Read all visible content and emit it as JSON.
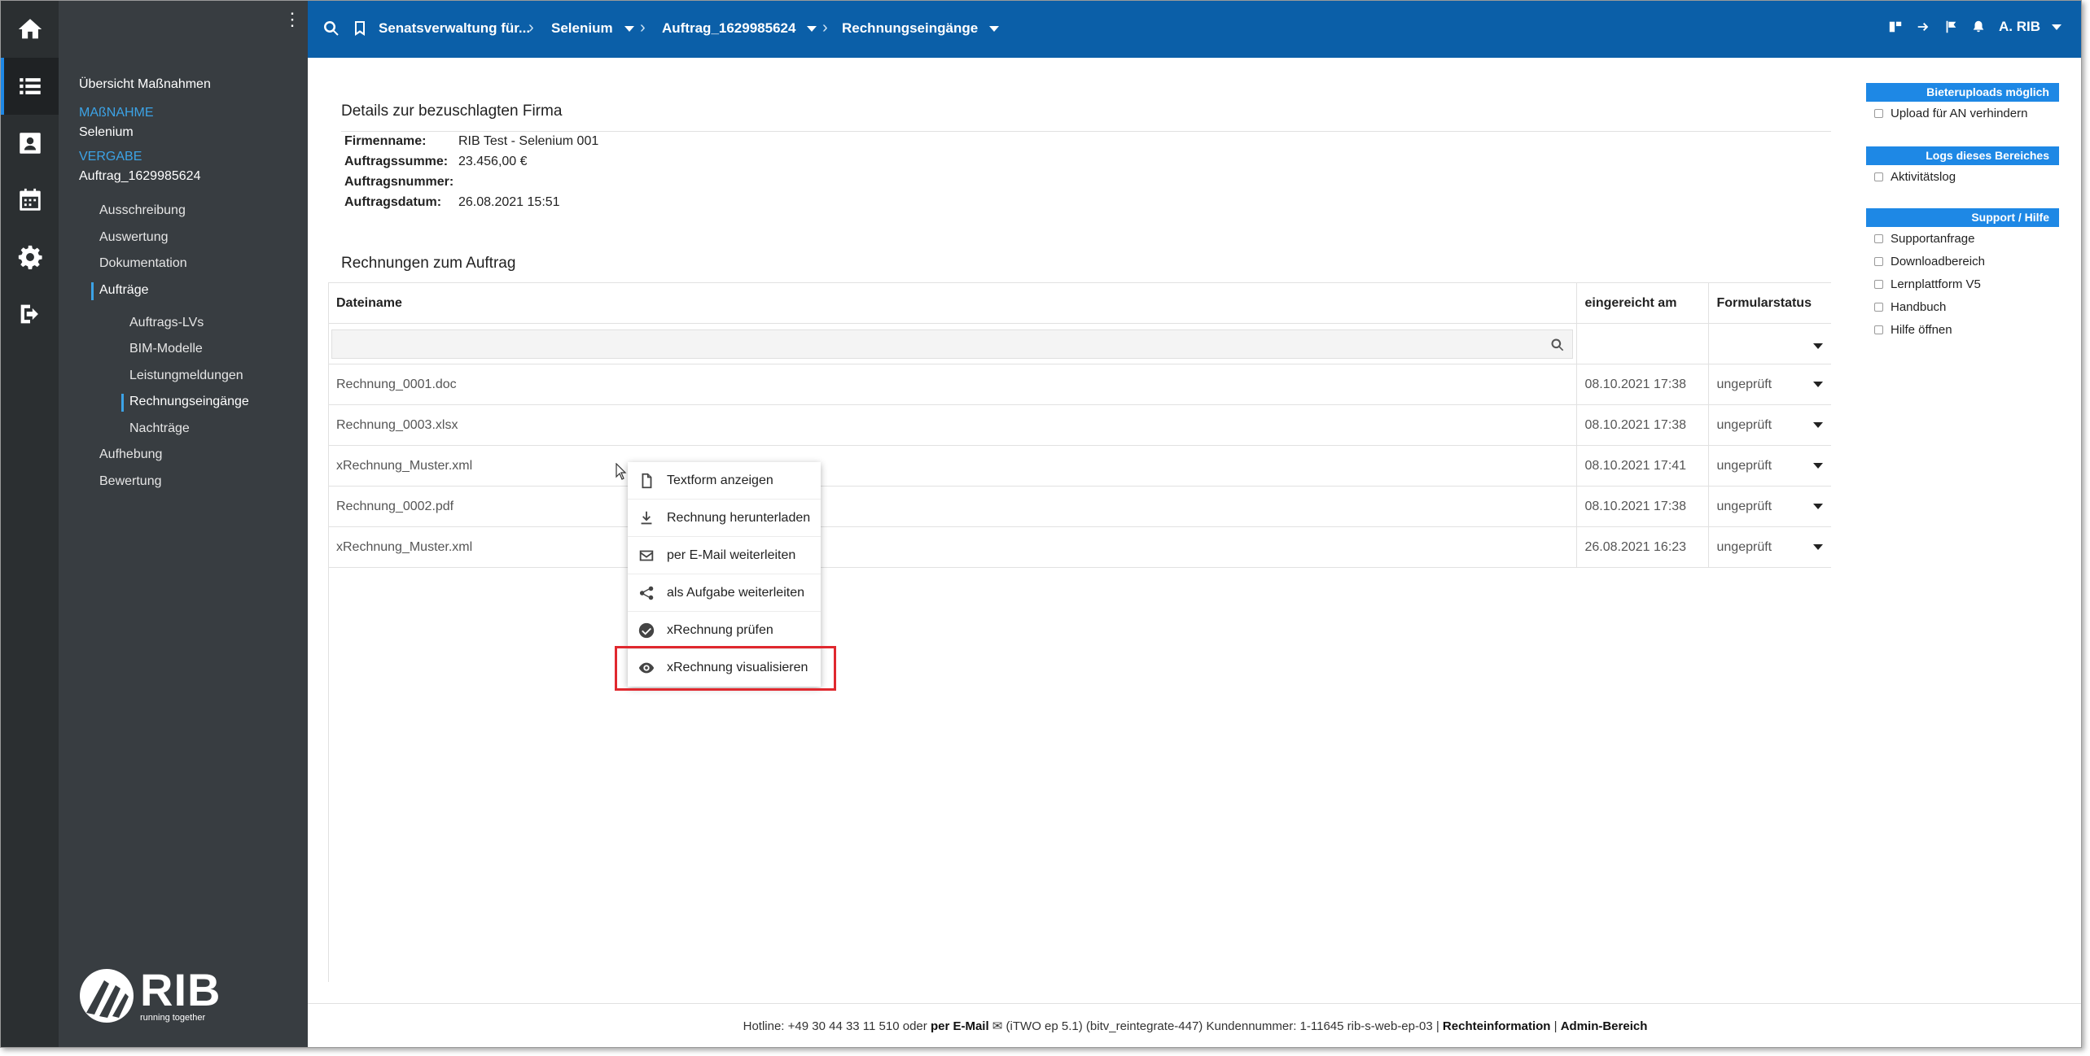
{
  "nav": {
    "overview": "Übersicht Maßnahmen",
    "massnahme_label": "MAßNAHME",
    "massnahme_value": "Selenium",
    "vergabe_label": "VERGABE",
    "vergabe_value": "Auftrag_1629985624",
    "items": [
      "Ausschreibung",
      "Auswertung",
      "Dokumentation",
      "Aufträge"
    ],
    "subitems": [
      "Auftrags-LVs",
      "BIM-Modelle",
      "Leistungmeldungen",
      "Rechnungseingänge",
      "Nachträge"
    ],
    "items_after": [
      "Aufhebung",
      "Bewertung"
    ],
    "logo_text": "RIB",
    "logo_tagline": "running together"
  },
  "topbar": {
    "crumbs": [
      "Senatsverwaltung für...",
      "Selenium",
      "Auftrag_1629985624",
      "Rechnungseingänge"
    ],
    "user": "A. RIB"
  },
  "details": {
    "title": "Details zur bezuschlagten Firma",
    "rows": [
      {
        "k": "Firmenname:",
        "v": "RIB Test - Selenium 001"
      },
      {
        "k": "Auftragssumme:",
        "v": "23.456,00 €"
      },
      {
        "k": "Auftragsnummer:",
        "v": ""
      },
      {
        "k": "Auftragsdatum:",
        "v": "26.08.2021 15:51"
      }
    ]
  },
  "invoices": {
    "title": "Rechnungen zum Auftrag",
    "columns": [
      "Dateiname",
      "eingereicht am",
      "Formularstatus"
    ],
    "rows": [
      {
        "file": "Rechnung_0001.doc",
        "date": "08.10.2021 17:38",
        "status": "ungeprüft"
      },
      {
        "file": "Rechnung_0003.xlsx",
        "date": "08.10.2021 17:38",
        "status": "ungeprüft"
      },
      {
        "file": "xRechnung_Muster.xml",
        "date": "08.10.2021 17:41",
        "status": "ungeprüft"
      },
      {
        "file": "Rechnung_0002.pdf",
        "date": "08.10.2021 17:38",
        "status": "ungeprüft"
      },
      {
        "file": "xRechnung_Muster.xml",
        "date": "26.08.2021 16:23",
        "status": "ungeprüft"
      }
    ]
  },
  "context_menu": {
    "items": [
      {
        "label": "Textform anzeigen",
        "icon": "document-icon"
      },
      {
        "label": "Rechnung herunterladen",
        "icon": "download-icon"
      },
      {
        "label": "per E-Mail weiterleiten",
        "icon": "mail-icon"
      },
      {
        "label": "als Aufgabe weiterleiten",
        "icon": "share-icon"
      },
      {
        "label": "xRechnung prüfen",
        "icon": "check-circle-icon"
      },
      {
        "label": "xRechnung visualisieren",
        "icon": "eye-icon"
      }
    ]
  },
  "right_panel": {
    "sections": [
      {
        "title": "Bieteruploads möglich",
        "items": [
          "Upload für AN verhindern"
        ]
      },
      {
        "title": "Logs dieses Bereiches",
        "items": [
          "Aktivitätslog"
        ]
      },
      {
        "title": "Support / Hilfe",
        "items": [
          "Supportanfrage",
          "Downloadbereich",
          "Lernplattform V5",
          "Handbuch",
          "Hilfe öffnen"
        ]
      }
    ]
  },
  "footer": {
    "hotline": "Hotline: +49 30 44 33 11 510 oder",
    "email_label": "per E-Mail",
    "meta": "(iTWO ep 5.1) (bitv_reintegrate-447)   Kundennummer: 1-11645 rib-s-web-ep-03 |",
    "legal": "Rechteinformation",
    "sep": "|",
    "admin": "Admin-Bereich"
  },
  "colors": {
    "topbar": "#0b5fa8",
    "rail": "#2b2f31",
    "nav": "#383d41",
    "accent": "#1e88e5",
    "highlight": "#e0282e"
  }
}
